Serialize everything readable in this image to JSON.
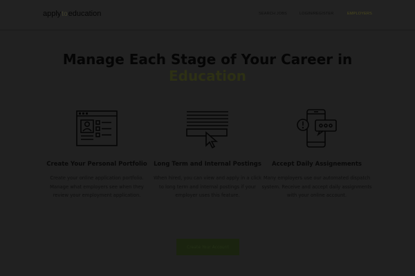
{
  "header": {
    "logo": {
      "part1": "apply",
      "part2": "to",
      "part3": "education"
    },
    "nav": [
      {
        "label": "SEARCH JOBS",
        "active": false
      },
      {
        "label": "LOGIN/REGISTER",
        "active": false
      },
      {
        "label": "EMPLOYERS",
        "active": true
      }
    ]
  },
  "hero": {
    "title_line1": "Manage Each Stage of Your Career in",
    "title_line2": "Education"
  },
  "features": [
    {
      "icon": "portfolio-browser-icon",
      "title": "Create Your Personal Portfolio",
      "description": "Create your online application portfolio. Manage what employers see when they review your employment application."
    },
    {
      "icon": "postings-click-icon",
      "title": "Long Term and Internal Postings",
      "description": "When hired, you can view and apply in a click to long term and internal postings if your employer uses this feature."
    },
    {
      "icon": "mobile-alert-icon",
      "title": "Accept Daily Assignements",
      "description": "Many employers use our automated dispatch system.  Receive and accept daily assignments with your online account."
    }
  ],
  "cta": {
    "label": "Create Your Account"
  },
  "colors": {
    "background": "#212121",
    "accent": "#2d3014",
    "button": "#1a230f"
  }
}
